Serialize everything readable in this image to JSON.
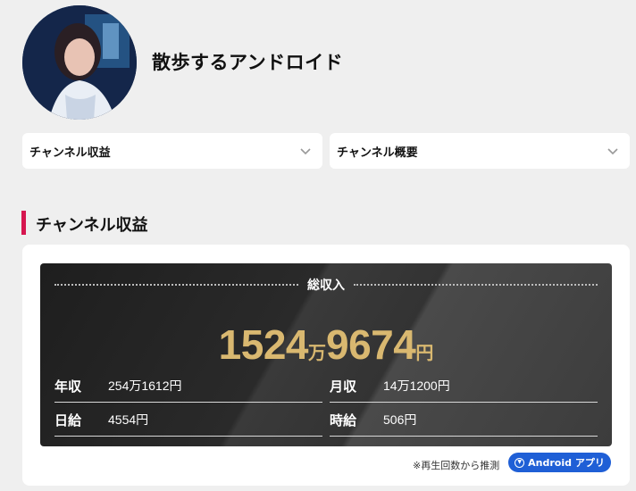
{
  "channel": {
    "name": "散歩するアンドロイド"
  },
  "dropdowns": [
    {
      "label": "チャンネル収益"
    },
    {
      "label": "チャンネル概要"
    }
  ],
  "section": {
    "title": "チャンネル収益"
  },
  "revenue": {
    "total_label": "総収入",
    "total_part1": "1524",
    "total_unit1": "万",
    "total_part2": "9674",
    "total_unit2": "円",
    "stats": [
      {
        "key": "年収",
        "value": "254万1612円"
      },
      {
        "key": "月収",
        "value": "14万1200円"
      },
      {
        "key": "日給",
        "value": "4554円"
      },
      {
        "key": "時給",
        "value": "506円"
      }
    ]
  },
  "footer": {
    "note": "※再生回数から推測",
    "android_button_label": "Android アプリ"
  },
  "colors": {
    "accent": "#d6164f",
    "gold": "#d9b870",
    "button_blue": "#1f5fd6"
  }
}
